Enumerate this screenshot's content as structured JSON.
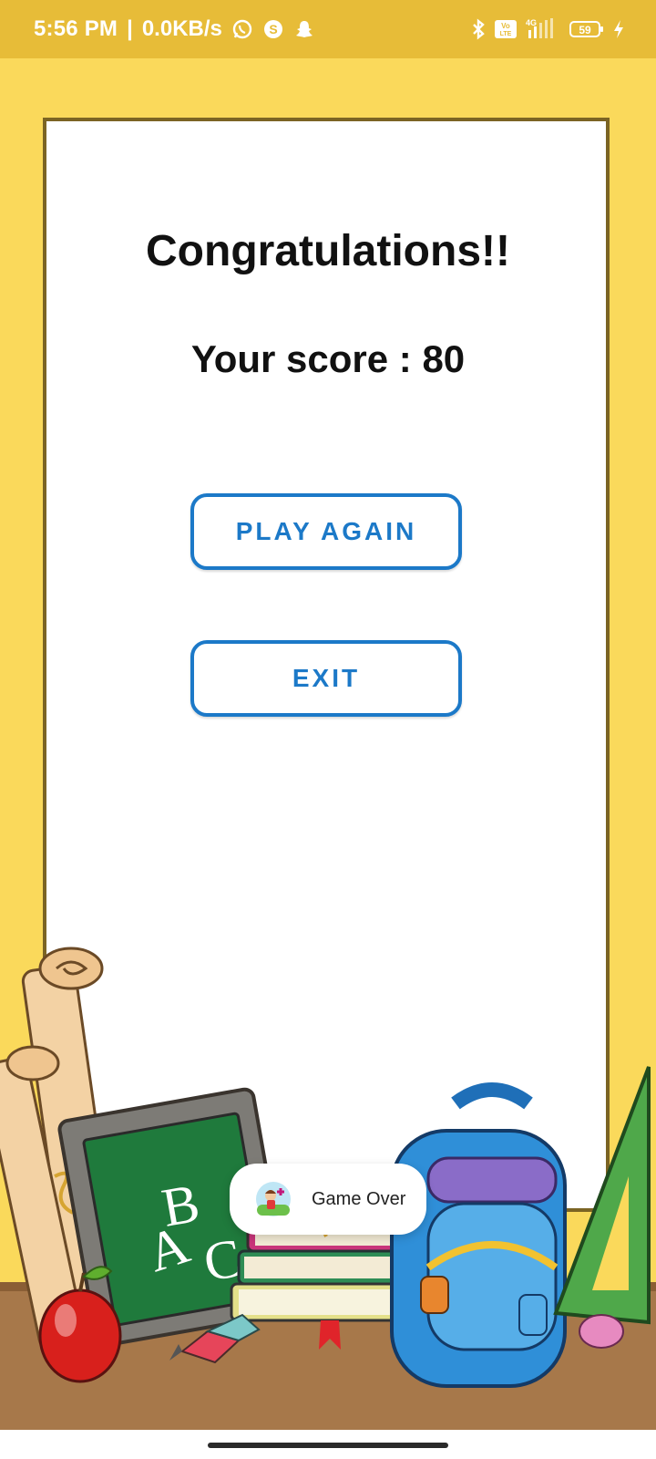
{
  "status_bar": {
    "time": "5:56 PM",
    "separator": "|",
    "speed": "0.0KB/s",
    "icons_left": [
      "whatsapp-icon",
      "skype-icon",
      "snapchat-icon"
    ],
    "icons_right": [
      "bluetooth-icon",
      "volte-icon",
      "signal-4g-icon",
      "battery-icon",
      "charging-icon"
    ],
    "network_label": "4G",
    "volte_label": "Vo LTE",
    "battery": "59"
  },
  "main": {
    "title": "Congratulations!!",
    "score_text": "Your score : 80",
    "play_again_label": "PLAY AGAIN",
    "exit_label": "EXIT"
  },
  "decoration": {
    "chalkboard_letters": [
      "A",
      "B",
      "C"
    ]
  },
  "toast": {
    "message": "Game Over"
  },
  "colors": {
    "background": "#FAD95B",
    "status_bar": "#E7BC38",
    "accent": "#1C79C8"
  }
}
